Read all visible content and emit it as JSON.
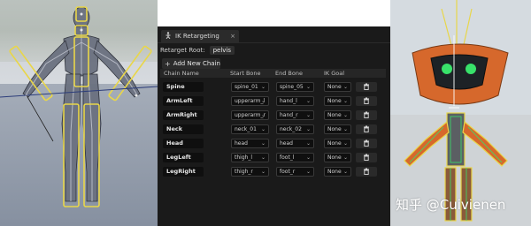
{
  "tab": {
    "title": "IK Retargeting",
    "close": "×"
  },
  "retarget_root": {
    "label": "Retarget Root:",
    "value": "pelvis"
  },
  "add_chain": {
    "label": "Add New Chain"
  },
  "columns": [
    "Chain Name",
    "Start Bone",
    "End Bone",
    "IK Goal"
  ],
  "rows": [
    {
      "name": "Spine",
      "start": "spine_01",
      "end": "spine_05",
      "goal": "None"
    },
    {
      "name": "ArmLeft",
      "start": "upperarm_l",
      "end": "hand_l",
      "goal": "None"
    },
    {
      "name": "ArmRight",
      "start": "upperarm_r",
      "end": "hand_r",
      "goal": "None"
    },
    {
      "name": "Neck",
      "start": "neck_01",
      "end": "neck_02",
      "goal": "None"
    },
    {
      "name": "Head",
      "start": "head",
      "end": "head",
      "goal": "None"
    },
    {
      "name": "LegLeft",
      "start": "thigh_l",
      "end": "foot_l",
      "goal": "None"
    },
    {
      "name": "LegRight",
      "start": "thigh_r",
      "end": "foot_r",
      "goal": "None"
    }
  ],
  "watermark": "知乎 @Cuivienen",
  "colors": {
    "panel_bg": "#1a1a1a",
    "chain_outline": "#e8d64a",
    "robot_orange": "#e0612a",
    "robot_eye": "#38e26a"
  },
  "icons": {
    "tab": "skeleton-icon",
    "add": "plus-icon",
    "delete": "trash-icon",
    "dropdown": "chevron-down-icon"
  }
}
